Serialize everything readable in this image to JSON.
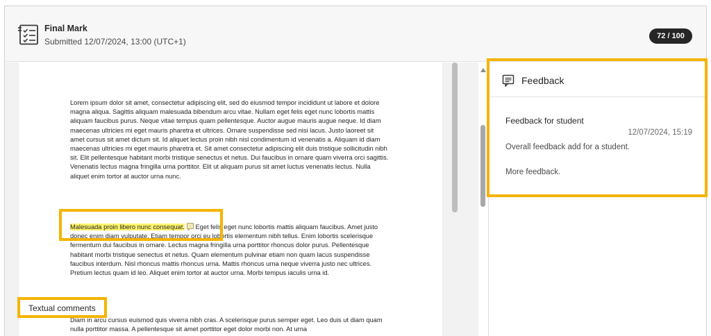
{
  "header": {
    "title": "Final Mark",
    "submitted": "Submitted 12/07/2024, 13:00 (UTC+1)",
    "score": "72 / 100"
  },
  "document": {
    "para1": "Lorem ipsum dolor sit amet, consectetur adipiscing elit, sed do eiusmod tempor incididunt ut labore et dolore magna aliqua. Sagittis aliquam malesuada bibendum arcu vitae. Nullam eget felis eget nunc lobortis mattis aliquam faucibus purus. Neque vitae tempus quam pellentesque. Auctor augue mauris augue neque. Id diam maecenas ultricies mi eget mauris pharetra et ultrices. Ornare suspendisse sed nisi lacus. Justo laoreet sit amet cursus sit amet dictum sit. Id aliquet lectus proin nibh nisl condimentum id venenatis a. Aliquam id diam maecenas ultricies mi eget mauris pharetra et. Sit amet consectetur adipiscing elit duis tristique sollicitudin nibh sit. Elit pellentesque habitant morbi tristique senectus et netus. Dui faucibus in ornare quam viverra orci sagittis. Venenatis lectus magna fringilla urna porttitor. Elit ut aliquam purus sit amet luctus venenatis lectus. Nulla aliquet enim tortor at auctor urna nunc.",
    "highlight": "Malesuada proin libero nunc consequat.",
    "para2_rest": "Eget felis eget nunc lobortis mattis aliquam faucibus. Amet justo donec enim diam vulputate. Etiam tempor orci eu lobortis elementum nibh tellus. Enim lobortis scelerisque fermentum dui faucibus in ornare. Lectus magna fringilla urna porttitor rhoncus dolor purus. Pellentesque habitant morbi tristique senectus et netus. Quam elementum pulvinar etiam non quam lacus suspendisse faucibus interdum. Nisl rhoncus mattis rhoncus urna. Mattis rhoncus urna neque viverra justo nec ultrices. Pretium lectus quam id leo. Aliquet enim tortor at auctor urna. Morbi tempus iaculis urna id.",
    "para3": "Diam in arcu cursus euismod quis viverra nibh cras. A scelerisque purus semper eget. Leo duis ut diam quam nulla porttitor massa. A pellentesque sit amet porttitor eget dolor morbi non. At urna"
  },
  "feedback": {
    "title": "Feedback",
    "for_student": "Feedback for student",
    "date": "12/07/2024, 15:19",
    "text1": "Overall feedback add for a student.",
    "text2": "More feedback."
  },
  "callouts": {
    "textual_comments": "Textual comments"
  },
  "colors": {
    "accent_callout": "#f5b400",
    "highlight": "#fff36b",
    "badge": "#262626"
  },
  "icons": {
    "header": "rubric-checklist-icon",
    "feedback": "feedback-note-icon",
    "comment": "comment-pin-icon"
  }
}
